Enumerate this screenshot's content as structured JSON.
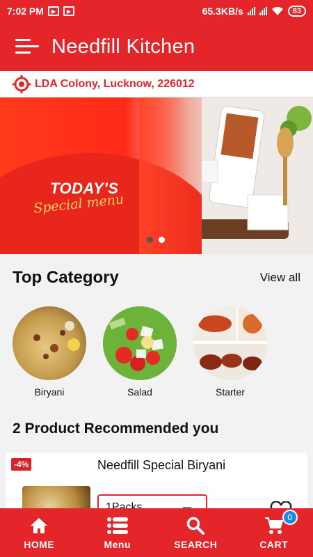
{
  "status_bar": {
    "time": "7:02 PM",
    "speed": "65.3KB/s",
    "battery": "83"
  },
  "app_bar": {
    "title": "Needfill Kitchen"
  },
  "location": {
    "text": "LDA Colony, Lucknow, 226012"
  },
  "banner": {
    "title": "TODAY'S",
    "subtitle": "Special menu",
    "slide_count": 2,
    "active_slide": 2
  },
  "top_category": {
    "title": "Top Category",
    "view_all": "View all",
    "items": [
      {
        "label": "Biryani"
      },
      {
        "label": "Salad"
      },
      {
        "label": "Starter"
      }
    ]
  },
  "recommended": {
    "title": "2 Product Recommended you",
    "products": [
      {
        "discount": "-4%",
        "name": "Needfill Special Biryani",
        "pack": "1Packs"
      }
    ]
  },
  "bottom_nav": {
    "items": [
      {
        "label": "HOME",
        "icon": "home-icon"
      },
      {
        "label": "Menu",
        "icon": "list-menu-icon"
      },
      {
        "label": "SEARCH",
        "icon": "search-icon"
      },
      {
        "label": "CART",
        "icon": "cart-icon"
      }
    ],
    "cart_count": "0"
  },
  "colors": {
    "primary": "#e4262b",
    "badge": "#1e88e5"
  }
}
